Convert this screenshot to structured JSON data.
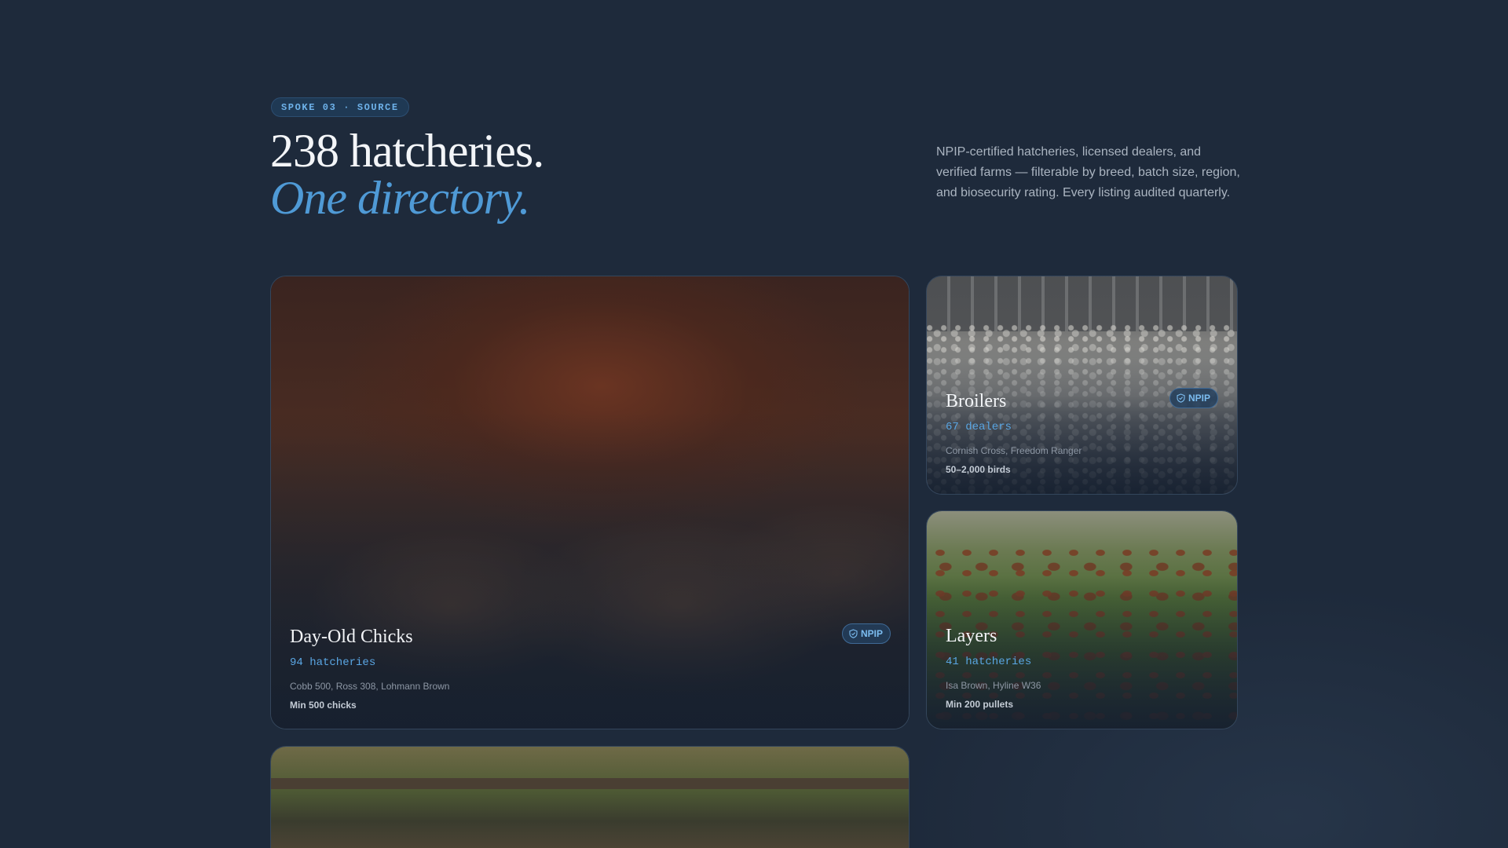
{
  "header": {
    "tag": "SPOKE 03 · SOURCE",
    "headline_line1": "238 hatcheries.",
    "headline_line2": "One directory.",
    "intro": "NPIP-certified hatcheries, licensed dealers, and verified farms — filterable by breed, batch size, region, and biosecurity rating. Every listing audited quarterly."
  },
  "cards": [
    {
      "title": "Day-Old Chicks",
      "count": "94 hatcheries",
      "breeds": "Cobb 500, Ross 308, Lohmann Brown",
      "min": "Min 500 chicks",
      "badge": "NPIP"
    },
    {
      "title": "Broilers",
      "count": "67 dealers",
      "breeds": "Cornish Cross, Freedom Ranger",
      "min": "50–2,000 birds",
      "badge": "NPIP"
    },
    {
      "title": "Layers",
      "count": "41 hatcheries",
      "breeds": "Isa Brown, Hyline W36",
      "min": "Min 200 pullets"
    }
  ],
  "colors": {
    "background": "#1e2a3b",
    "accent": "#4f9ad6",
    "badge_text": "#7cbdf0"
  },
  "icons": {
    "badge_icon": "shield-check-icon"
  }
}
